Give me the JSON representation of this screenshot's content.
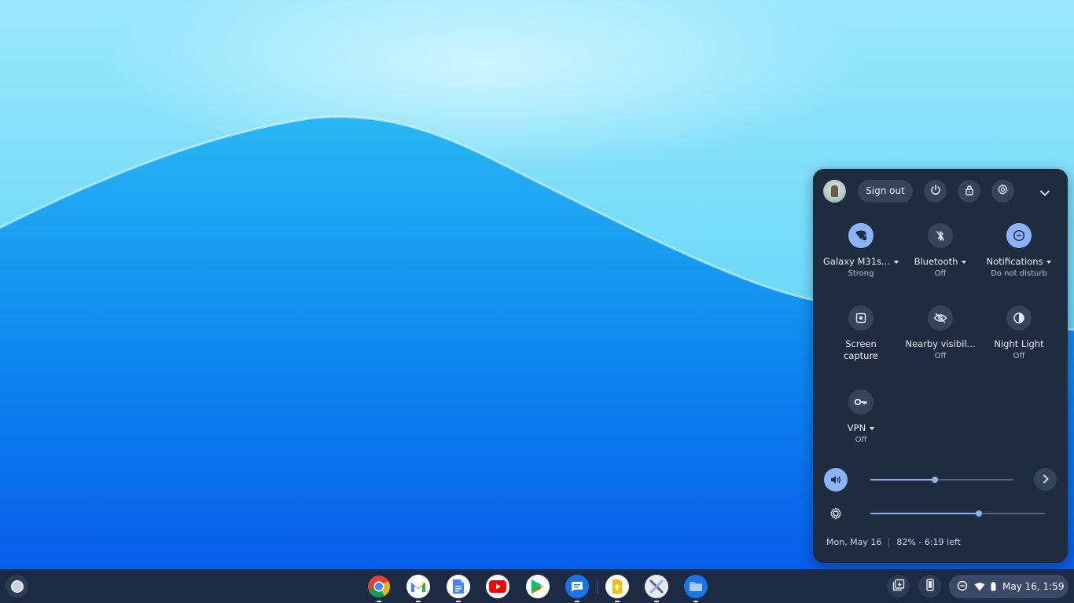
{
  "quick_settings": {
    "header": {
      "sign_out_label": "Sign out",
      "icons": [
        "power-icon",
        "lock-icon",
        "settings-icon",
        "collapse-chevron-icon"
      ]
    },
    "tiles": [
      {
        "label": "Galaxy M31s...",
        "sub": "Strong",
        "icon": "wifi-locked-icon",
        "active": true,
        "has_menu": true
      },
      {
        "label": "Bluetooth",
        "sub": "Off",
        "icon": "bluetooth-off-icon",
        "active": false,
        "has_menu": true
      },
      {
        "label": "Notifications",
        "sub": "Do not disturb",
        "icon": "do-not-disturb-icon",
        "active": true,
        "has_menu": true
      },
      {
        "label": "Screen capture",
        "sub": "",
        "icon": "screen-capture-icon",
        "active": false,
        "has_menu": false
      },
      {
        "label": "Nearby visibil...",
        "sub": "Off",
        "icon": "nearby-visibility-off-icon",
        "active": false,
        "has_menu": false
      },
      {
        "label": "Night Light",
        "sub": "Off",
        "icon": "night-light-icon",
        "active": false,
        "has_menu": false
      },
      {
        "label": "VPN",
        "sub": "Off",
        "icon": "vpn-key-icon",
        "active": false,
        "has_menu": true
      }
    ],
    "volume": {
      "level": 0.45,
      "icon": "volume-icon"
    },
    "brightness": {
      "level": 0.62,
      "icon": "brightness-icon"
    },
    "footer": {
      "date": "Mon, May 16",
      "battery": "82% - 6:19 left"
    },
    "colors": {
      "accent": "#8ab4f8",
      "panel": "#1f2b3e"
    }
  },
  "shelf": {
    "apps": [
      {
        "name": "Chrome",
        "icon": "chrome-icon",
        "running": true
      },
      {
        "name": "Gmail",
        "icon": "gmail-icon",
        "running": true
      },
      {
        "name": "Docs",
        "icon": "docs-icon",
        "running": true
      },
      {
        "name": "YouTube",
        "icon": "youtube-icon",
        "running": false
      },
      {
        "name": "Play Store",
        "icon": "play-store-icon",
        "running": false
      },
      {
        "name": "Messages",
        "icon": "messages-icon",
        "running": true
      },
      {
        "name": "Keep",
        "icon": "keep-icon",
        "running": true
      },
      {
        "name": "Tools",
        "icon": "tools-icon",
        "running": true
      },
      {
        "name": "Files",
        "icon": "files-icon",
        "running": true
      }
    ],
    "tray": {
      "clock": "May 16, 1:59",
      "icons": [
        "holding-space-icon",
        "phone-hub-icon",
        "do-not-disturb-icon",
        "wifi-icon",
        "battery-icon"
      ]
    }
  }
}
